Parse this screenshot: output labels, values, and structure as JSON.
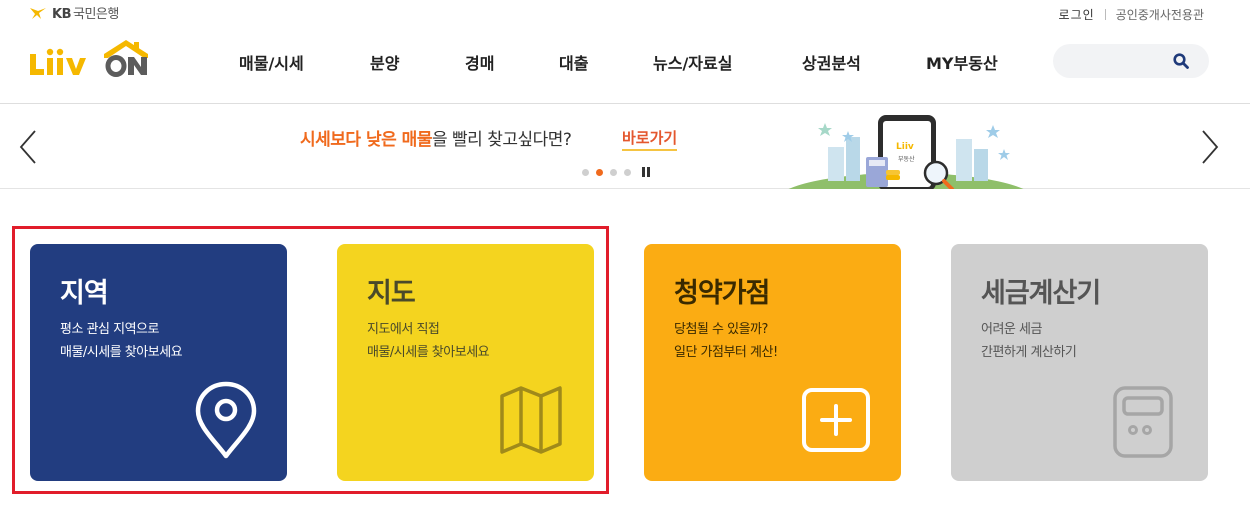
{
  "header": {
    "kb_brand": "KB",
    "kb_bank_name": "국민은행",
    "service_logo_alt": "Liiv ON",
    "login_label": "로그인",
    "agent_center_label": "공인중개사전용관",
    "nav": [
      {
        "label": "매물/시세"
      },
      {
        "label": "분양"
      },
      {
        "label": "경매"
      },
      {
        "label": "대출"
      },
      {
        "label": "뉴스/자료실"
      },
      {
        "label": "상권분석"
      },
      {
        "label": "MY부동산"
      }
    ],
    "search": {
      "value": "",
      "placeholder": ""
    },
    "logo_colors": {
      "yellow": "#f5b800",
      "gray": "#5c5c5c"
    }
  },
  "banner": {
    "highlight_text": "시세보다 낮은 매물",
    "normal_text": "을 빨리 찾고싶다면?",
    "link_label": "바로가기",
    "slide_count": 4,
    "active_slide": 2,
    "illustration_label": "부동산",
    "accent_color": "#f06a1d"
  },
  "cards": [
    {
      "title": "지역",
      "desc": [
        "평소 관심 지역으로",
        "매물/시세를 찾아보세요"
      ],
      "icon": "location-pin-icon",
      "color": "#223d80"
    },
    {
      "title": "지도",
      "desc": [
        "지도에서 직접",
        "매물/시세를 찾아보세요"
      ],
      "icon": "folded-map-icon",
      "color": "#f4d41f"
    },
    {
      "title": "청약가점",
      "desc": [
        "당첨될 수 있을까?",
        "일단 가점부터 계산!"
      ],
      "icon": "plus-square-icon",
      "color": "#fbac13"
    },
    {
      "title": "세금계산기",
      "desc": [
        "어려운 세금",
        "간편하게 계산하기"
      ],
      "icon": "calculator-icon",
      "color": "#cfcfcf"
    }
  ],
  "highlight_color": "#e11d2a"
}
